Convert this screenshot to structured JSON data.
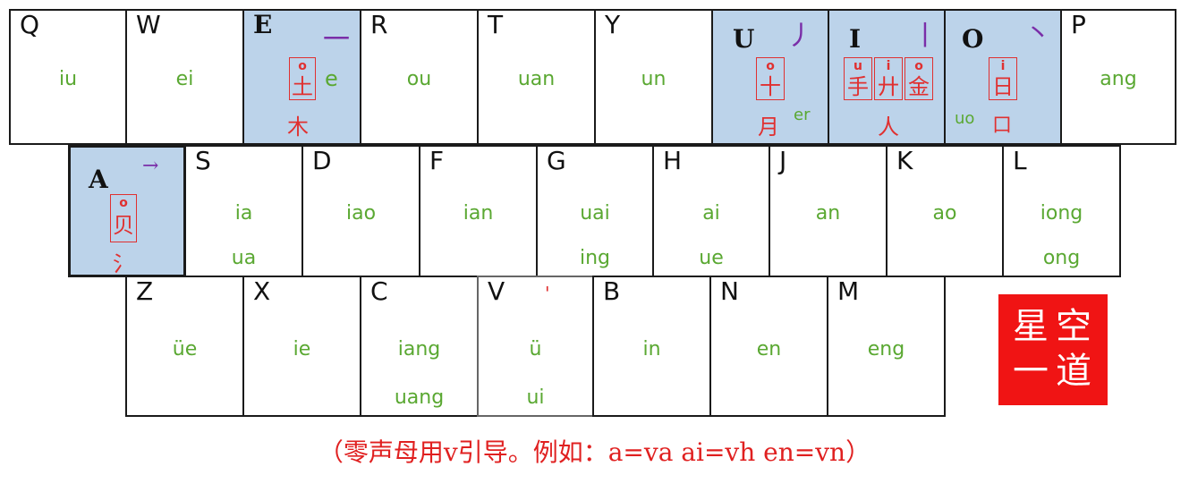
{
  "keys": {
    "q": {
      "letter": "Q",
      "finals": [
        "iu"
      ]
    },
    "w": {
      "letter": "W",
      "finals": [
        "ei"
      ]
    },
    "e": {
      "letter": "E",
      "stroke": "一",
      "root_sup": "o",
      "root": "土",
      "below": "木",
      "final": "e"
    },
    "r": {
      "letter": "R",
      "finals": [
        "ou"
      ]
    },
    "t": {
      "letter": "T",
      "finals": [
        "uan"
      ]
    },
    "y": {
      "letter": "Y",
      "finals": [
        "un"
      ]
    },
    "u": {
      "letter": "U",
      "stroke": "丿",
      "root_sup": "o",
      "root": "十",
      "below": "月",
      "final": "er"
    },
    "i": {
      "letter": "I",
      "stroke": "丨",
      "roots": [
        {
          "sup": "u",
          "char": "手"
        },
        {
          "sup": "i",
          "char": "廾"
        },
        {
          "sup": "o",
          "char": "金"
        }
      ],
      "below": "人"
    },
    "o": {
      "letter": "O",
      "stroke": "丶",
      "root_sup": "i",
      "root": "日",
      "below": "口",
      "final": "uo"
    },
    "p": {
      "letter": "P",
      "finals": [
        "ang"
      ]
    },
    "a": {
      "letter": "A",
      "stroke": "→",
      "root_sup": "o",
      "root": "贝",
      "below": "氵"
    },
    "s": {
      "letter": "S",
      "finals": [
        "ia",
        "ua"
      ]
    },
    "d": {
      "letter": "D",
      "finals": [
        "iao"
      ]
    },
    "f": {
      "letter": "F",
      "finals": [
        "ian"
      ]
    },
    "g": {
      "letter": "G",
      "finals": [
        "uai",
        "ing"
      ]
    },
    "h": {
      "letter": "H",
      "finals": [
        "ai",
        "ue"
      ]
    },
    "j": {
      "letter": "J",
      "finals": [
        "an"
      ]
    },
    "k": {
      "letter": "K",
      "finals": [
        "ao"
      ]
    },
    "l": {
      "letter": "L",
      "finals": [
        "iong",
        "ong"
      ]
    },
    "z": {
      "letter": "Z",
      "finals": [
        "üe"
      ]
    },
    "x": {
      "letter": "X",
      "finals": [
        "ie"
      ]
    },
    "c": {
      "letter": "C",
      "finals": [
        "iang",
        "uang"
      ]
    },
    "v": {
      "letter": "V",
      "mark": "'",
      "finals": [
        "ü",
        "ui"
      ]
    },
    "b": {
      "letter": "B",
      "finals": [
        "in"
      ]
    },
    "n": {
      "letter": "N",
      "finals": [
        "en"
      ]
    },
    "m": {
      "letter": "M",
      "finals": [
        "eng"
      ]
    }
  },
  "logo": {
    "chars": [
      "星",
      "空",
      "一",
      "道"
    ]
  },
  "note": "（零声母用v引导。例如：a=va ai=vh en=vn）",
  "colors": {
    "highlight": "#bcd3ea",
    "final_green": "#5aa832",
    "root_red": "#e03030",
    "stroke_purple": "#7a2ea8",
    "logo_red": "#f01414"
  }
}
